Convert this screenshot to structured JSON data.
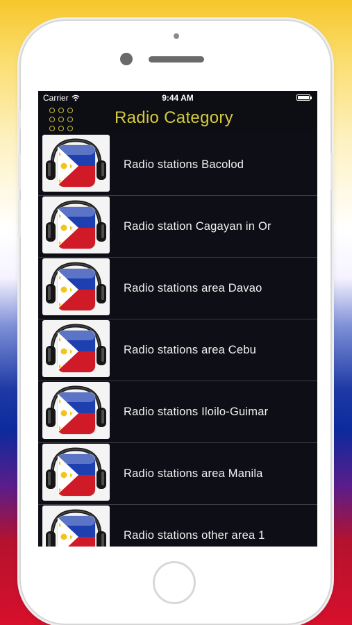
{
  "status_bar": {
    "carrier": "Carrier",
    "time": "9:44 AM"
  },
  "nav": {
    "title": "Radio Category",
    "menu_icon": "grid-menu-icon"
  },
  "colors": {
    "title": "#d6cb3c",
    "screen_background": "#0d0d14",
    "flag_blue": "#1d3fb0",
    "flag_red": "#d01a27",
    "flag_yellow": "#f3c41b"
  },
  "stations": [
    {
      "label": "Radio stations Bacolod",
      "icon": "philippines-flag-headphones-icon"
    },
    {
      "label": "Radio station Cagayan in Or",
      "icon": "philippines-flag-headphones-icon"
    },
    {
      "label": "Radio stations area Davao",
      "icon": "philippines-flag-headphones-icon"
    },
    {
      "label": "Radio stations area Cebu",
      "icon": "philippines-flag-headphones-icon"
    },
    {
      "label": "Radio stations Iloilo-Guimar",
      "icon": "philippines-flag-headphones-icon"
    },
    {
      "label": "Radio stations area Manila",
      "icon": "philippines-flag-headphones-icon"
    },
    {
      "label": "Radio stations other area 1",
      "icon": "philippines-flag-headphones-icon"
    }
  ]
}
